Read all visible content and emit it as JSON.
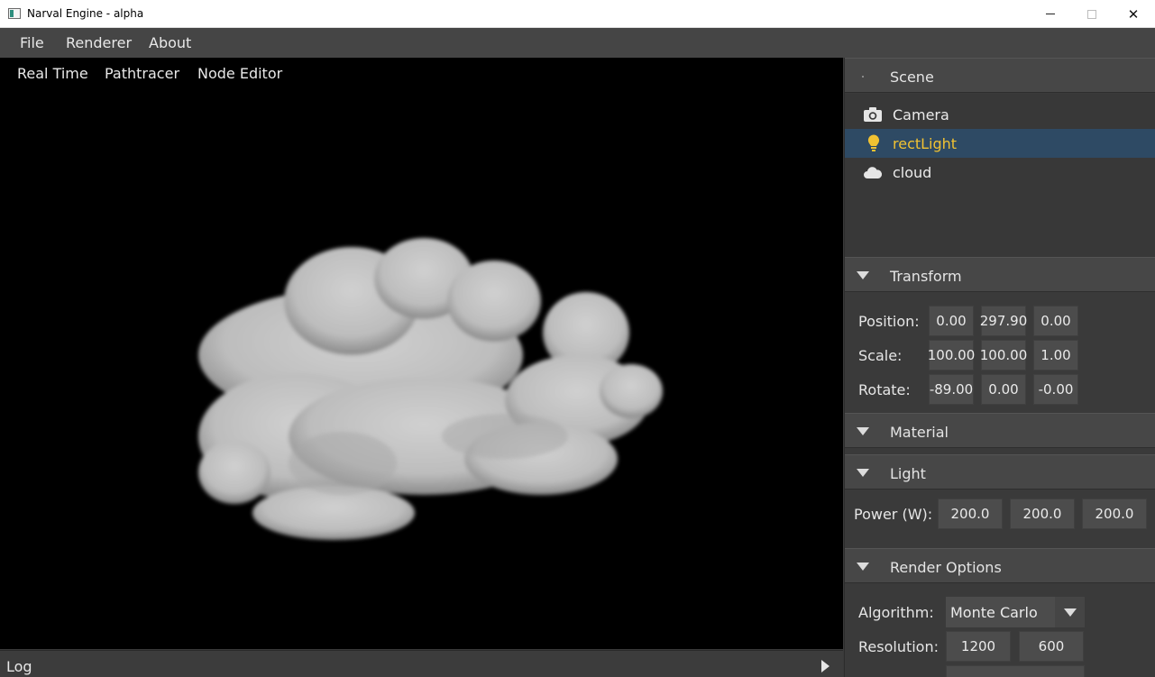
{
  "window": {
    "title": "Narval Engine - alpha",
    "controls": {
      "minimize": "",
      "maximize": "",
      "close": "✕"
    }
  },
  "menu": {
    "items": [
      "File",
      "Renderer",
      "About"
    ]
  },
  "viewport": {
    "tabs": [
      "Real Time",
      "Pathtracer",
      "Node Editor"
    ],
    "content": "cloud"
  },
  "log": {
    "label": "Log"
  },
  "scene": {
    "header": "Scene",
    "items": [
      {
        "name": "Camera",
        "icon": "camera-icon"
      },
      {
        "name": "rectLight",
        "icon": "lightbulb-icon",
        "selected": true
      },
      {
        "name": "cloud",
        "icon": "cloud-icon"
      }
    ]
  },
  "transform": {
    "header": "Transform",
    "position": {
      "label": "Position:",
      "values": [
        "0.00",
        "297.90",
        "0.00"
      ]
    },
    "scale": {
      "label": "Scale:",
      "values": [
        "100.00",
        "100.00",
        "1.00"
      ]
    },
    "rotate": {
      "label": "Rotate:",
      "values": [
        "-89.00",
        "0.00",
        "-0.00"
      ]
    }
  },
  "material": {
    "header": "Material"
  },
  "light": {
    "header": "Light",
    "power": {
      "label": "Power (W):",
      "values": [
        "200.0",
        "200.0",
        "200.0"
      ]
    }
  },
  "render_options": {
    "header": "Render Options",
    "algorithm": {
      "label": "Algorithm:",
      "value": "Monte Carlo"
    },
    "resolution": {
      "label": "Resolution:",
      "values": [
        "1200",
        "600"
      ]
    }
  },
  "colors": {
    "selection_bg": "#2e4a64",
    "selection_text": "#f1c232",
    "panel_bg": "#3a3a3a",
    "viewport_bg": "#000000"
  }
}
